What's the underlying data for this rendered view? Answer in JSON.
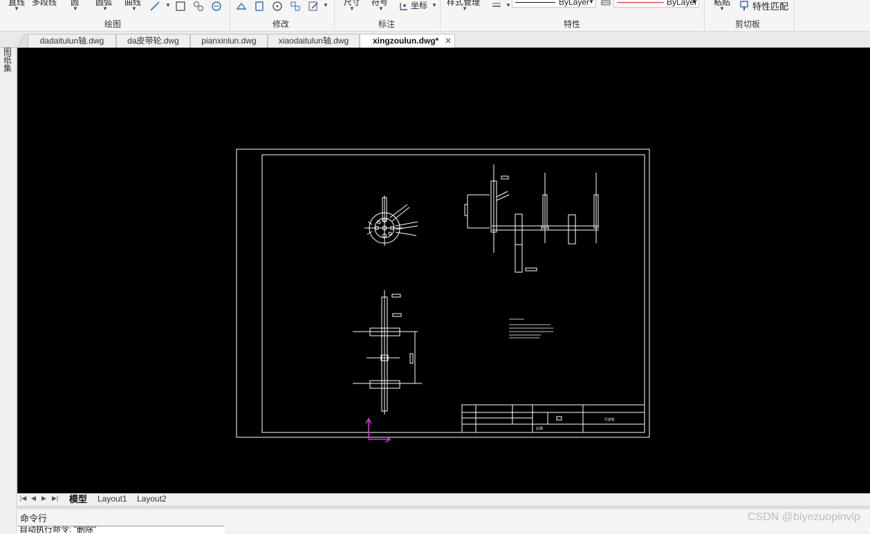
{
  "ribbon": {
    "draw_top_labels": [
      "直线",
      "多段线",
      "圆",
      "圆弧",
      "曲线"
    ],
    "annot_top_labels": [
      "尺寸",
      "符号",
      "坐标"
    ],
    "props_top_label": "样式管理",
    "linetype_label": "ByLayer",
    "lineweight_label": "ByLayer",
    "clip_top_label": "粘贴",
    "match_props_label": "特性匹配",
    "panels": {
      "draw": "绘图",
      "modify": "修改",
      "annotate": "标注",
      "properties": "特性",
      "clipboard": "剪切板"
    },
    "accent_color": "#2b6cc4"
  },
  "tabs": [
    {
      "label": "dadaitulun轴.dwg"
    },
    {
      "label": "da皮带轮.dwg"
    },
    {
      "label": "pianxinlun.dwg"
    },
    {
      "label": "xiaodaitulun轴.dwg"
    },
    {
      "label": "xingzoulun.dwg*",
      "active": true
    }
  ],
  "side_label": "图纸集",
  "layout_tabs": [
    "模型",
    "Layout1",
    "Layout2"
  ],
  "command": {
    "title": "命令行",
    "last_line": "自动执行命令: \"删除\""
  },
  "watermark": "CSDN @biyezuopinvip",
  "drawing": {
    "background": "#000000",
    "line_color": "#ffffff",
    "ucs_color": "#d63bd6",
    "title_block": {
      "scale_label": "比例",
      "drawing_name_label": "行走轮"
    }
  }
}
